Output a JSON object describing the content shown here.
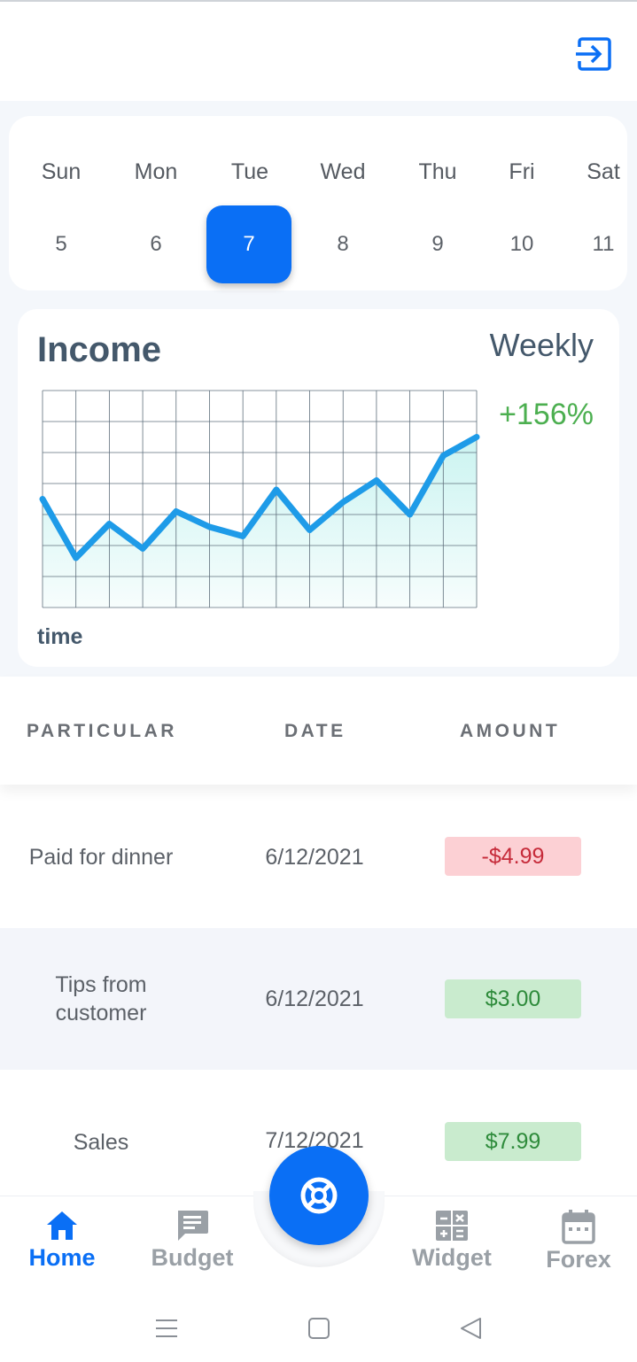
{
  "header": {
    "logout_icon": "exit-to-app-icon"
  },
  "calendar": {
    "selected_index": 2,
    "days": [
      {
        "name": "Sun",
        "date": "5"
      },
      {
        "name": "Mon",
        "date": "6"
      },
      {
        "name": "Tue",
        "date": "7"
      },
      {
        "name": "Wed",
        "date": "8"
      },
      {
        "name": "Thu",
        "date": "9"
      },
      {
        "name": "Fri",
        "date": "10"
      },
      {
        "name": "Sat",
        "date": "11"
      }
    ],
    "accent": "#0a6ff5"
  },
  "income": {
    "title": "Income",
    "period": "Weekly",
    "change": "+156%",
    "xlabel": "time",
    "change_color": "#4caf50"
  },
  "chart_data": {
    "type": "area",
    "title": "Income",
    "xlabel": "time",
    "ylabel": "",
    "grid": true,
    "ylim": [
      0,
      7
    ],
    "x": [
      0,
      1,
      2,
      3,
      4,
      5,
      6,
      7,
      8,
      9,
      10,
      11,
      12,
      13
    ],
    "values": [
      3.5,
      1.6,
      2.7,
      1.9,
      3.1,
      2.6,
      2.3,
      3.8,
      2.5,
      3.4,
      4.1,
      3.0,
      4.9,
      5.5
    ],
    "line_color": "#1e9be8",
    "fill_color": "#c8f3f0"
  },
  "table": {
    "headers": {
      "particular": "PARTICULAR",
      "date": "DATE",
      "amount": "AMOUNT"
    },
    "rows": [
      {
        "particular": "Paid for dinner",
        "date": "6/12/2021",
        "amount": "-$4.99",
        "type": "negative"
      },
      {
        "particular": "Tips from customer",
        "date": "6/12/2021",
        "amount": "$3.00",
        "type": "positive"
      },
      {
        "particular": "Sales",
        "date": "7/12/2021",
        "amount": "$7.99",
        "type": "positive"
      }
    ]
  },
  "nav": {
    "items": [
      {
        "label": "Home",
        "icon": "home-icon",
        "active": true
      },
      {
        "label": "Budget",
        "icon": "chat-icon",
        "active": false
      },
      {
        "label": "Widget",
        "icon": "calculator-icon",
        "active": false
      },
      {
        "label": "Forex",
        "icon": "calendar-icon",
        "active": false
      }
    ],
    "fab_icon": "lifebuoy-icon",
    "active_color": "#0a6ff5",
    "inactive_color": "#9aa0a6"
  },
  "system_nav": [
    "menu-icon",
    "home-square-icon",
    "back-triangle-icon"
  ]
}
